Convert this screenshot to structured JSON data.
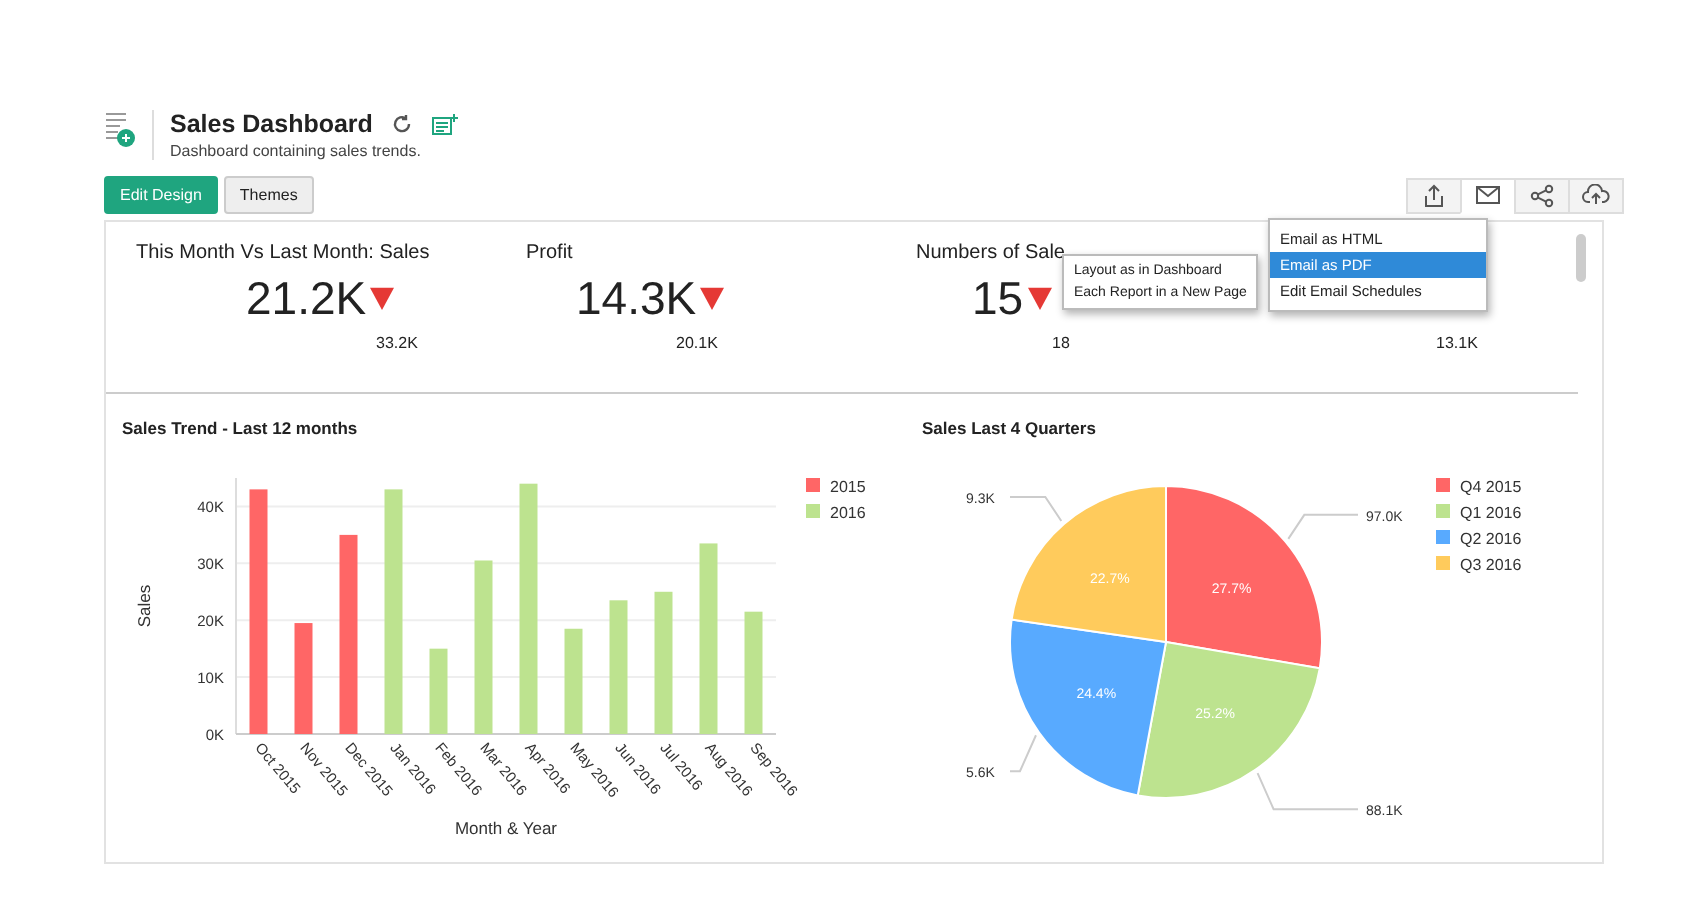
{
  "header": {
    "title": "Sales Dashboard",
    "subtitle": "Dashboard containing sales trends."
  },
  "buttons": [
    {
      "label": "Edit Design",
      "kind": "primary"
    },
    {
      "label": "Themes",
      "kind": "secondary"
    }
  ],
  "toolbar": [
    {
      "kind": "export",
      "selected": false
    },
    {
      "kind": "mail",
      "selected": true
    },
    {
      "kind": "share",
      "selected": false
    },
    {
      "kind": "upload",
      "selected": false
    }
  ],
  "kpis": [
    {
      "title": "This Month Vs Last Month: Sales",
      "value": "21.2K",
      "previous": "33.2K",
      "down": true
    },
    {
      "title": "Profit",
      "value": "14.3K",
      "previous": "20.1K",
      "down": true
    },
    {
      "title": "Numbers of Sale",
      "value": "15",
      "previous": "18",
      "down": true
    },
    {
      "previous": "13.1K"
    }
  ],
  "email_menu": [
    {
      "label": "Email as HTML",
      "selected": false
    },
    {
      "label": "Email as PDF",
      "selected": true
    },
    {
      "label": "Edit Email Schedules",
      "selected": false
    }
  ],
  "pdf_submenu": [
    "Layout as in Dashboard",
    "Each Report in a New Page"
  ],
  "charts": [
    {
      "chart_data": {
        "type": "bar",
        "title": "Sales Trend - Last 12 months",
        "xlabel": "Month & Year",
        "ylabel": "Sales",
        "categories": [
          "Oct 2015",
          "Nov 2015",
          "Dec 2015",
          "Jan 2016",
          "Feb 2016",
          "Mar 2016",
          "Apr 2016",
          "May 2016",
          "Jun 2016",
          "Jul 2016",
          "Aug 2016",
          "Sep 2016"
        ],
        "series": [
          {
            "name": "2015",
            "color": "#ff6666",
            "values": [
              43,
              19.5,
              35,
              null,
              null,
              null,
              null,
              null,
              null,
              null,
              null,
              null
            ]
          },
          {
            "name": "2016",
            "color": "#bde38f",
            "values": [
              null,
              null,
              null,
              43,
              15,
              30.5,
              44,
              18.5,
              23.5,
              25,
              33.5,
              21.5
            ]
          }
        ],
        "ylim": [
          0,
          45
        ],
        "grid": true,
        "legend": true,
        "yticks": [
          {
            "value": 0,
            "label": "0K"
          },
          {
            "value": 10,
            "label": "10K"
          },
          {
            "value": 20,
            "label": "20K"
          },
          {
            "value": 30,
            "label": "30K"
          },
          {
            "value": 40,
            "label": "40K"
          }
        ]
      }
    },
    {
      "chart_data": {
        "type": "pie",
        "title": "Sales Last 4 Quarters",
        "categories": [
          "Q4 2015",
          "Q1 2016",
          "Q2 2016",
          "Q3 2016"
        ],
        "values": [
          27.7,
          25.2,
          24.4,
          22.7
        ],
        "legend": true,
        "colors": [
          "#ff6666",
          "#bde38f",
          "#58aaff",
          "#ffcb5c"
        ],
        "value_labels": [
          "27.7%",
          "25.2%",
          "24.4%",
          "22.7%"
        ],
        "annotations": [
          "97.0K",
          "88.1K",
          "5.6K",
          "9.3K"
        ]
      }
    }
  ]
}
